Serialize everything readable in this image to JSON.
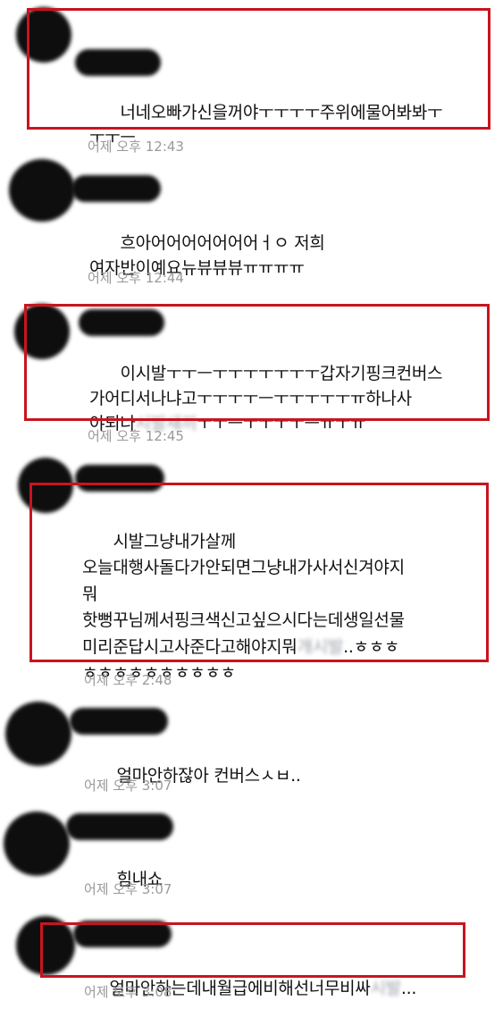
{
  "messages": [
    {
      "text": "너네오빠가신을꺼야ㅜㅜㅜㅜ주위에물어봐봐ㅜ\nㅜㅜㅡ",
      "censored": "",
      "tail": "",
      "time": "어제 오후 12:43",
      "highlighted": true
    },
    {
      "text": "흐아어어어어어어어ㅓㅇ 저희\n여자반이예요뉴뷰뷰뷰ㅠㅠㅠㅠ",
      "censored": "",
      "tail": "",
      "time": "어제 오후 12:44",
      "highlighted": false
    },
    {
      "text": "이시발ㅜㅜㅡㅜㅜㅜㅜㅜㅜㅜ갑자기핑크컨버스\n가어디서나냐고ㅜㅜㅜㅜㅡㅜㅜㅜㅜㅜㅠ하나사\n야되나",
      "censored": "시발새끼",
      "tail": "ㅜㅜㅡㅜㅜㅜㅜㅡㅠㅜㅠ",
      "time": "어제 오후 12:45",
      "highlighted": true
    },
    {
      "text": "시발그냥내가살께\n오늘대행사돌다가안되면그냥내가사서신겨야지\n뭐\n핫뻥꾸님께서핑크색신고싶으시다는데생일선물\n미리준답시고사준다고해야지뭐",
      "censored": "개시발",
      "tail": "..ㅎㅎㅎ\nㅎㅎㅎㅎㅎㅎㅎㅎㅎㅎ",
      "time": "어제 오후 2:48",
      "highlighted": true
    },
    {
      "text": "얼마안하잖아 컨버스ㅅㅂ..",
      "censored": "",
      "tail": "",
      "time": "어제 오후 3:07",
      "highlighted": false
    },
    {
      "text": "힘내쇼",
      "censored": "",
      "tail": "",
      "time": "어제 오후 3:07",
      "highlighted": false
    },
    {
      "text": "얼마안하는데내월급에비해선너무비싸",
      "censored": "시발",
      "tail": "...",
      "time": "어제 오후 3:08",
      "highlighted": true
    }
  ]
}
